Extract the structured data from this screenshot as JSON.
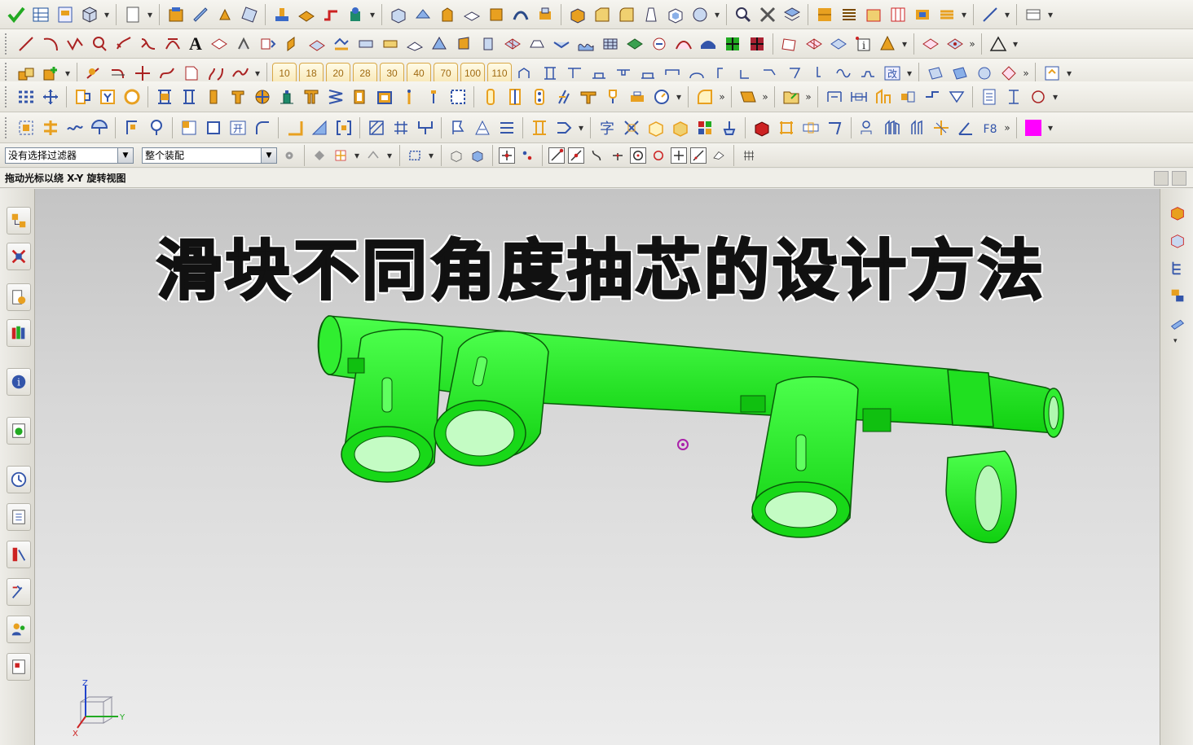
{
  "filter_bar": {
    "selection_filter": "没有选择过滤器",
    "assembly_scope": "整个装配"
  },
  "status_bar": {
    "prompt": "拖动光标以绕 X-Y 旋转视图"
  },
  "toolbar_numbers": [
    "10",
    "18",
    "20",
    "28",
    "30",
    "40",
    "70",
    "100",
    "110"
  ],
  "toolbar_text_tools": {
    "annotation": "A",
    "font_tool": "字",
    "f8_tool": "F8",
    "change_tool": "改",
    "open_tool": "开"
  },
  "viewport": {
    "title_overlay": "滑块不同角度抽芯的设计方法",
    "model_color": "#1cf21c",
    "triad": {
      "z": "Z",
      "y": "Y",
      "x": "X"
    }
  },
  "colors": {
    "swatch": "#ff00ff",
    "accent_orange": "#e8a020"
  }
}
